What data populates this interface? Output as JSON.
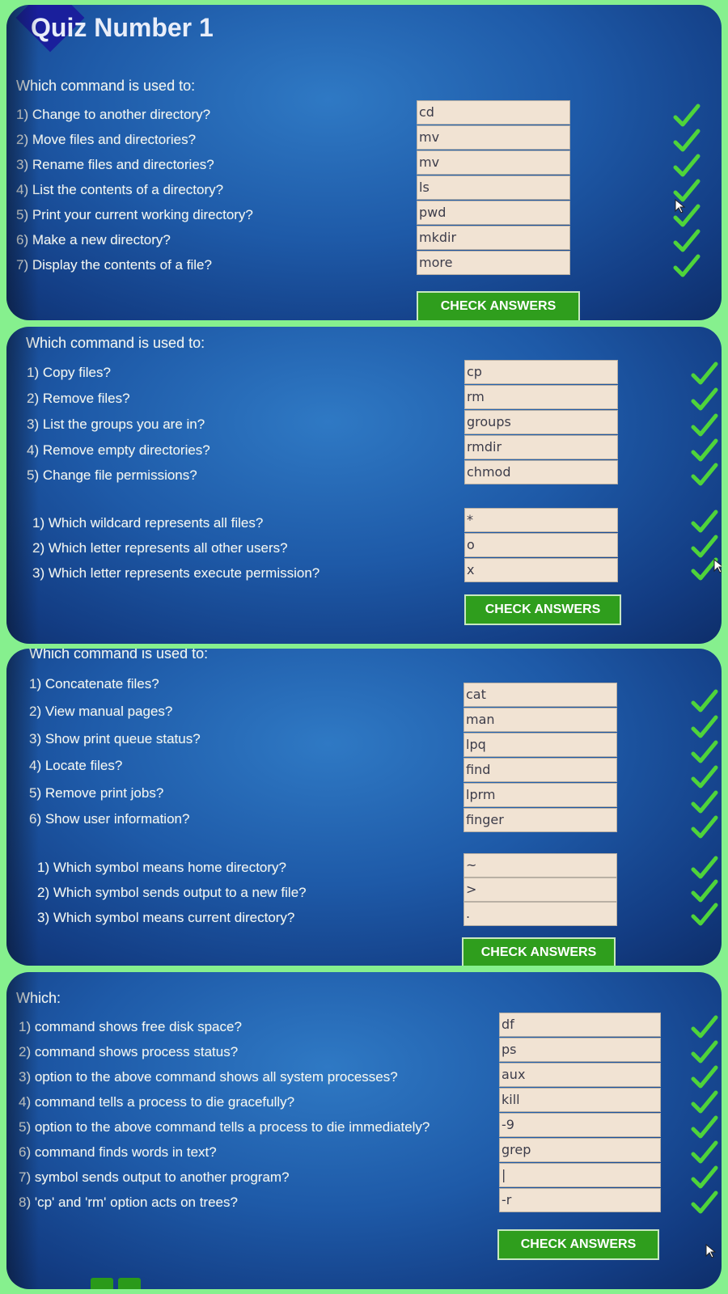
{
  "quiz_title": "Quiz Number 1",
  "button_label": "CHECK ANSWERS",
  "panel1": {
    "header": "Which command is used to:",
    "questions": [
      {
        "q": "1) Change to another directory?",
        "a": "cd"
      },
      {
        "q": "2) Move files and directories?",
        "a": "mv"
      },
      {
        "q": "3) Rename files and directories?",
        "a": "mv"
      },
      {
        "q": "4) List the contents of a directory?",
        "a": "ls"
      },
      {
        "q": "5) Print your current working directory?",
        "a": "pwd"
      },
      {
        "q": "6) Make a new directory?",
        "a": "mkdir"
      },
      {
        "q": "7) Display the contents of a file?",
        "a": "more"
      }
    ]
  },
  "panel2": {
    "header": "Which command is used to:",
    "questions": [
      {
        "q": "1) Copy files?",
        "a": "cp"
      },
      {
        "q": "2) Remove files?",
        "a": "rm"
      },
      {
        "q": "3) List the groups you are in?",
        "a": "groups"
      },
      {
        "q": "4) Remove empty directories?",
        "a": "rmdir"
      },
      {
        "q": "5) Change file permissions?",
        "a": "chmod"
      }
    ],
    "questions_b": [
      {
        "q": "1) Which wildcard represents all files?",
        "a": "*"
      },
      {
        "q": "2) Which letter represents all other users?",
        "a": "o"
      },
      {
        "q": "3) Which letter represents execute permission?",
        "a": "x"
      }
    ]
  },
  "panel3": {
    "header": "Which command is used to:",
    "questions": [
      {
        "q": "1) Concatenate files?",
        "a": "cat"
      },
      {
        "q": "2) View manual pages?",
        "a": "man"
      },
      {
        "q": "3) Show print queue status?",
        "a": "lpq"
      },
      {
        "q": "4) Locate files?",
        "a": "find"
      },
      {
        "q": "5) Remove print jobs?",
        "a": "lprm"
      },
      {
        "q": "6) Show user information?",
        "a": "finger"
      }
    ],
    "questions_b": [
      {
        "q": "1) Which symbol means home directory?",
        "a": "~"
      },
      {
        "q": "2) Which symbol sends output to a new file?",
        "a": ">"
      },
      {
        "q": "3) Which symbol means current directory?",
        "a": "."
      }
    ]
  },
  "panel4": {
    "header": "Which:",
    "questions": [
      {
        "q": "1) command shows free disk space?",
        "a": "df"
      },
      {
        "q": "2) command shows process status?",
        "a": "ps"
      },
      {
        "q": "3) option to the above command shows all system processes?",
        "a": "aux"
      },
      {
        "q": "4) command tells a process to die gracefully?",
        "a": "kill"
      },
      {
        "q": "5) option to the above command tells a process to die immediately?",
        "a": "-9"
      },
      {
        "q": "6) command finds words in text?",
        "a": "grep"
      },
      {
        "q": "7) symbol sends output to another program?",
        "a": "|"
      },
      {
        "q": "8) 'cp' and 'rm' option acts on trees?",
        "a": "-r"
      }
    ]
  },
  "colors": {
    "page_background": "#86f08e",
    "panel_blue": "#1e5aa8",
    "answer_box": "#f1e3d3",
    "button_green": "#2f9e1d",
    "checkmark_green": "#4fd43a"
  },
  "icons": {
    "correct": "checkmark-icon",
    "nav_prev": "arrow-left-icon",
    "nav_next": "arrow-right-icon",
    "pointer": "mouse-cursor-icon"
  }
}
